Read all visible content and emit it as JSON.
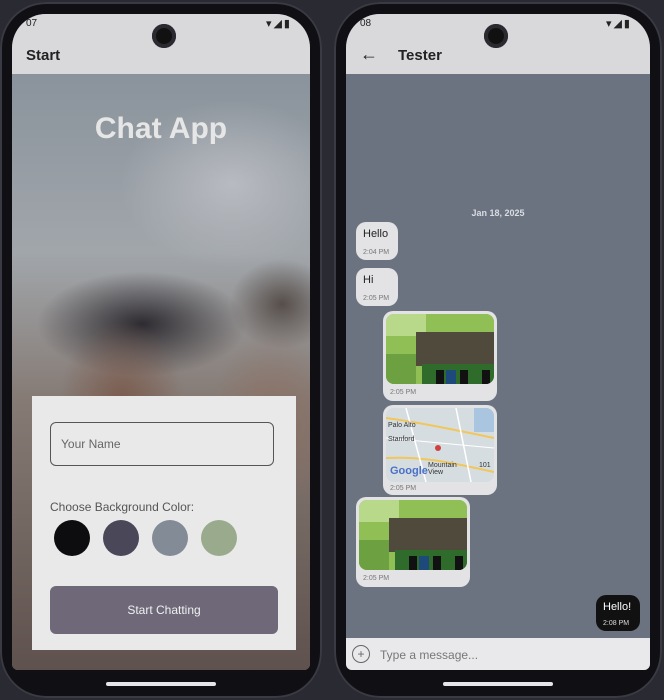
{
  "left_phone": {
    "status_time": "07",
    "appbar_title": "Start",
    "app_title": "Chat App",
    "name_input": {
      "placeholder": "Your Name",
      "value": ""
    },
    "color_label": "Choose Background Color:",
    "swatches": [
      {
        "name": "black",
        "color": "#0d0d10"
      },
      {
        "name": "purple-gray",
        "color": "#4a4758"
      },
      {
        "name": "slate",
        "color": "#838b97"
      },
      {
        "name": "sage",
        "color": "#9aab8d"
      }
    ],
    "start_button": "Start Chatting"
  },
  "right_phone": {
    "status_time": "08",
    "chat_title": "Tester",
    "date_separator": "Jan 18, 2025",
    "messages": [
      {
        "type": "text",
        "text": "Hello",
        "time": "2:04 PM",
        "own": false
      },
      {
        "type": "text",
        "text": "Hi",
        "time": "2:05 PM",
        "own": false
      },
      {
        "type": "image",
        "time": "2:05 PM",
        "own": false
      },
      {
        "type": "map",
        "time": "2:05 PM",
        "own": false,
        "labels": [
          "Palo Alto",
          "Stanford",
          "Mountain View",
          "101"
        ],
        "logo": "Google"
      },
      {
        "type": "image",
        "time": "2:05 PM",
        "own": false
      },
      {
        "type": "text",
        "text": "Hello!",
        "time": "2:08 PM",
        "own": true
      }
    ],
    "input": {
      "placeholder": "Type a message...",
      "value": ""
    }
  },
  "colors": {
    "chat_bg": "#6c7380",
    "own_bubble": "#111111",
    "other_bubble": "#e3e3e6",
    "button": "#6e6878"
  }
}
